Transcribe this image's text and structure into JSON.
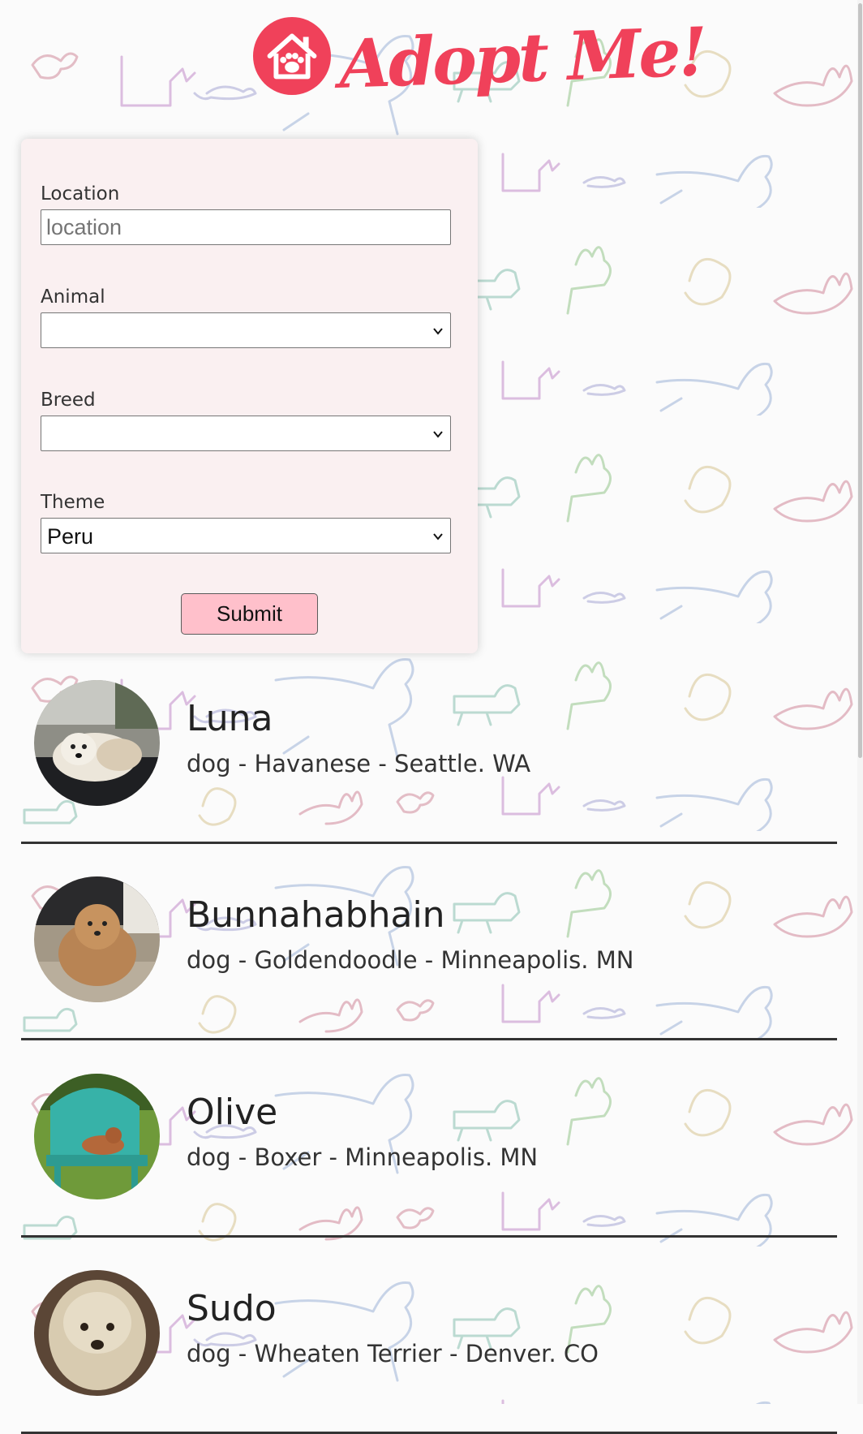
{
  "header": {
    "logo_text": "Adopt Me!",
    "logo_icon": "house-paw-icon",
    "brand_color": "#f0415a"
  },
  "search_form": {
    "location": {
      "label": "Location",
      "placeholder": "location",
      "value": ""
    },
    "animal": {
      "label": "Animal",
      "selected": ""
    },
    "breed": {
      "label": "Breed",
      "selected": ""
    },
    "theme": {
      "label": "Theme",
      "selected": "Peru"
    },
    "submit_label": "Submit",
    "submit_color": "#ffc0cb"
  },
  "pets": [
    {
      "name": "Luna",
      "info": "dog - Havanese - Seattle. WA"
    },
    {
      "name": "Bunnahabhain",
      "info": "dog - Goldendoodle - Minneapolis. MN"
    },
    {
      "name": "Olive",
      "info": "dog - Boxer - Minneapolis. MN"
    },
    {
      "name": "Sudo",
      "info": "dog - Wheaten Terrier - Denver. CO"
    }
  ]
}
